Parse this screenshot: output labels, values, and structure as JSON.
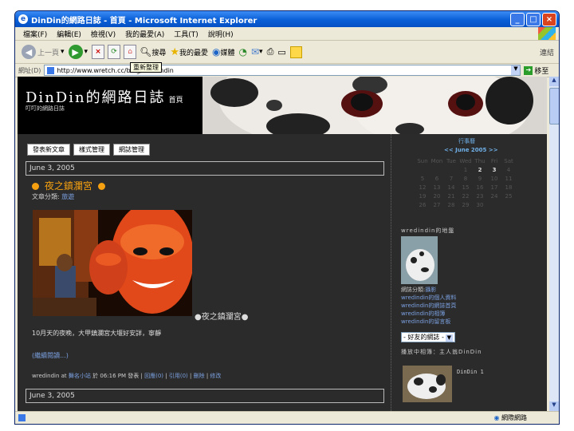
{
  "window": {
    "title": "DinDin的網路日誌 - 首頁 - Microsoft Internet Explorer"
  },
  "menu": [
    "檔案(F)",
    "編輯(E)",
    "檢視(V)",
    "我的最愛(A)",
    "工具(T)",
    "說明(H)"
  ],
  "toolbar": {
    "back_label": "上一頁",
    "search_label": "搜尋",
    "favorites_label": "我的最愛",
    "media_label": "媒體",
    "tooltip": "重新整理",
    "links_label": "連結"
  },
  "address": {
    "label": "網址(D)",
    "value": "http://www.wretch.cc/blog/wredindin",
    "go_label": "移至"
  },
  "blog": {
    "title": "DinDin的網路日誌",
    "home_label": "首頁",
    "subtitle": "叮叮的網路日誌",
    "buttons": [
      "發表新文章",
      "樣式管理",
      "網誌管理"
    ]
  },
  "post": {
    "date": "June 3, 2005",
    "title": "夜之鎮瀾宮",
    "category_prefix": "文章分類:",
    "category": "旅遊",
    "caption": "●夜之鎮瀾宮●",
    "excerpt": "10月天的夜晚，大甲鎮瀾宮大堰好安詳，寧靜",
    "more": "(繼續閱讀...)",
    "footer": {
      "author": "wredindin",
      "at": "at",
      "section": "舞名小站",
      "time_text": "於 06:16 PM 發表",
      "sep": "|",
      "reply": "回應(0)",
      "cite": "引用(0)",
      "delete": "刪除",
      "edit": "修改"
    },
    "next_date": "June 3, 2005"
  },
  "sidebar": {
    "calendar": {
      "title": "行事曆",
      "nav": "<< June 2005 >>",
      "weekdays": [
        "Sun",
        "Mon",
        "Tue",
        "Wed",
        "Thu",
        "Fri",
        "Sat"
      ],
      "weeks": [
        [
          "",
          "",
          "",
          "1",
          "2",
          "3",
          "4"
        ],
        [
          "5",
          "6",
          "7",
          "8",
          "9",
          "10",
          "11"
        ],
        [
          "12",
          "13",
          "14",
          "15",
          "16",
          "17",
          "18"
        ],
        [
          "19",
          "20",
          "21",
          "22",
          "23",
          "24",
          "25"
        ],
        [
          "26",
          "27",
          "28",
          "29",
          "30",
          "",
          ""
        ]
      ],
      "highlighted": [
        "1",
        "2",
        "3"
      ]
    },
    "profile": {
      "heading": "wredindin的地盤",
      "category_prefix": "網誌分類:",
      "category": "攝影",
      "links": [
        "wredindin的個人資料",
        "wredindin的網誌首頁",
        "wredindin的相簿",
        "wredindin的留言板"
      ],
      "select_value": "- 好友的網誌 -"
    },
    "album": {
      "heading": "播放中相簿：主人翁DinDin",
      "photo_label": "DinDin 1"
    }
  },
  "status": {
    "zone": "網際網路"
  }
}
